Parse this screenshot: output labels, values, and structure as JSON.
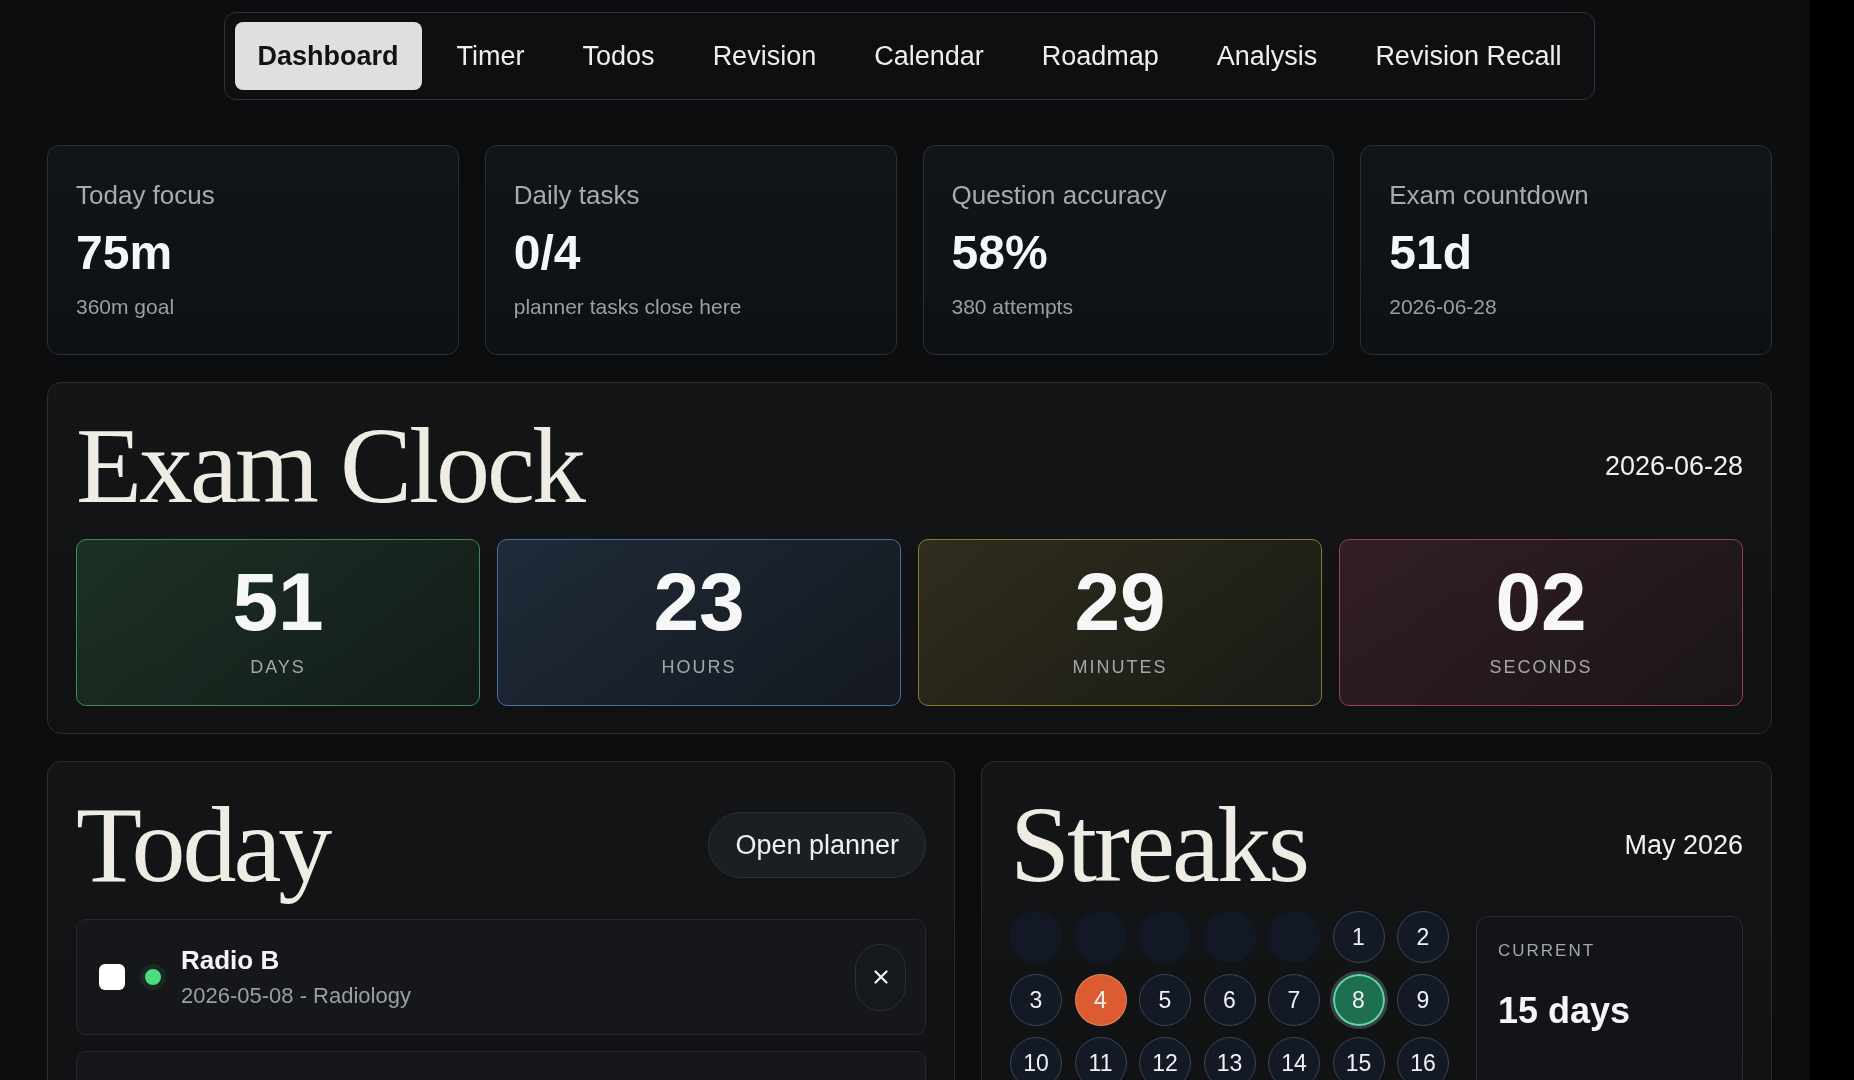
{
  "nav": {
    "tabs": [
      {
        "label": "Dashboard",
        "selected": true
      },
      {
        "label": "Timer",
        "selected": false
      },
      {
        "label": "Todos",
        "selected": false
      },
      {
        "label": "Revision",
        "selected": false
      },
      {
        "label": "Calendar",
        "selected": false
      },
      {
        "label": "Roadmap",
        "selected": false
      },
      {
        "label": "Analysis",
        "selected": false
      },
      {
        "label": "Revision Recall",
        "selected": false
      }
    ]
  },
  "stats": [
    {
      "label": "Today focus",
      "value": "75m",
      "note": "360m goal"
    },
    {
      "label": "Daily tasks",
      "value": "0/4",
      "note": "planner tasks close here"
    },
    {
      "label": "Question accuracy",
      "value": "58%",
      "note": "380 attempts"
    },
    {
      "label": "Exam countdown",
      "value": "51d",
      "note": "2026-06-28"
    }
  ],
  "exam_clock": {
    "title": "Exam Clock",
    "date": "2026-06-28",
    "units": [
      {
        "value": "51",
        "label": "DAYS",
        "color": "#3f8a53"
      },
      {
        "value": "23",
        "label": "HOURS",
        "color": "#4a6ea3"
      },
      {
        "value": "29",
        "label": "MINUTES",
        "color": "#8c7a34"
      },
      {
        "value": "02",
        "label": "SECONDS",
        "color": "#94404f"
      }
    ]
  },
  "today": {
    "title": "Today",
    "button": "Open planner",
    "tasks": [
      {
        "title": "Radio B",
        "meta": "2026-05-08 - Radiology",
        "done": false,
        "color": "#4ade80"
      }
    ],
    "more_below": true
  },
  "streaks": {
    "title": "Streaks",
    "month": "May 2026",
    "cells": [
      {
        "kind": "blank"
      },
      {
        "kind": "blank"
      },
      {
        "kind": "blank"
      },
      {
        "kind": "blank"
      },
      {
        "kind": "blank"
      },
      {
        "kind": "day",
        "day": "1",
        "today": false
      },
      {
        "kind": "day",
        "day": "2",
        "today": false
      },
      {
        "kind": "day",
        "day": "3",
        "today": false
      },
      {
        "kind": "day",
        "day": "4",
        "today": false,
        "color": "#dd5b30"
      },
      {
        "kind": "day",
        "day": "5",
        "today": false
      },
      {
        "kind": "day",
        "day": "6",
        "today": false
      },
      {
        "kind": "day",
        "day": "7",
        "today": false
      },
      {
        "kind": "day",
        "day": "8",
        "today": true,
        "color": "#1e6e50"
      },
      {
        "kind": "day",
        "day": "9",
        "today": false
      },
      {
        "kind": "day",
        "day": "10",
        "today": false
      },
      {
        "kind": "day",
        "day": "11",
        "today": false
      },
      {
        "kind": "day",
        "day": "12",
        "today": false
      },
      {
        "kind": "day",
        "day": "13",
        "today": false
      },
      {
        "kind": "day",
        "day": "14",
        "today": false
      },
      {
        "kind": "day",
        "day": "15",
        "today": false
      },
      {
        "kind": "day",
        "day": "16",
        "today": false
      }
    ],
    "current": {
      "label": "CURRENT",
      "value": "15 days"
    }
  }
}
